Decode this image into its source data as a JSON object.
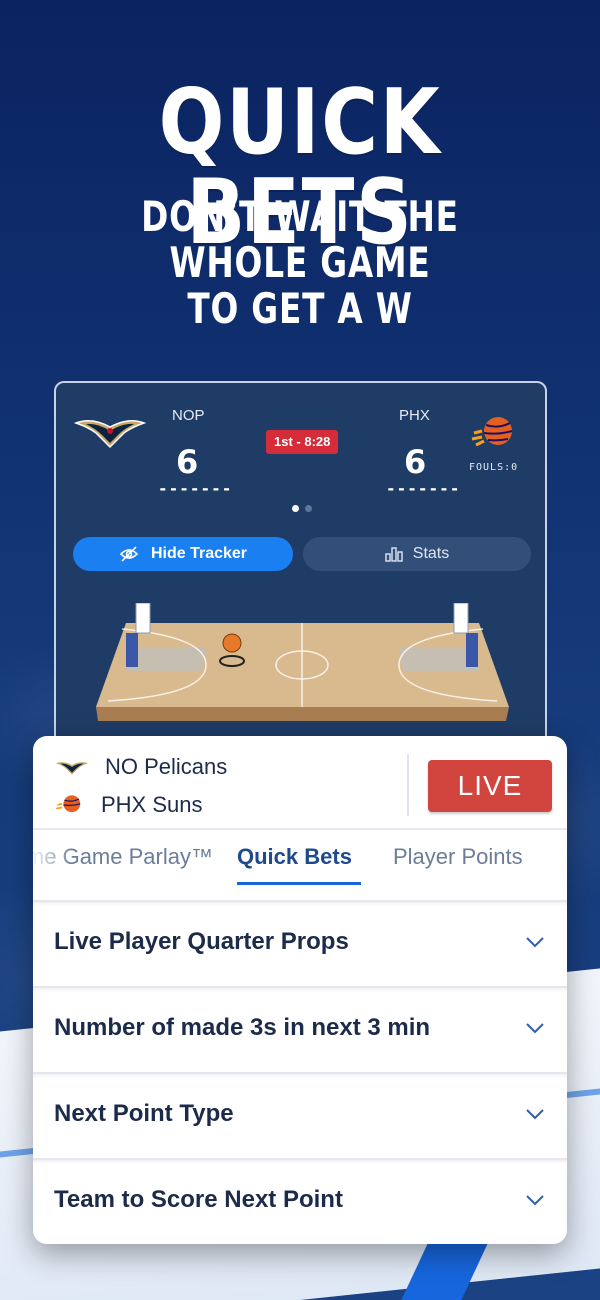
{
  "hero": {
    "title": "QUICK BETS",
    "subtitle_line1": "DON’T WAIT THE WHOLE GAME",
    "subtitle_line2": "TO GET A W"
  },
  "tracker": {
    "home": {
      "abbr": "NOP",
      "score": "6",
      "shots": "-------"
    },
    "away": {
      "abbr": "PHX",
      "score": "6",
      "shots": "-------",
      "fouls": "FOULS:0"
    },
    "clock": "1st - 8:28",
    "pager": {
      "total": 2,
      "active": 1
    },
    "hide_tracker_label": "Hide Tracker",
    "stats_label": "Stats"
  },
  "matchup": {
    "team1": "NO Pelicans",
    "team2": "PHX Suns",
    "live_label": "LIVE"
  },
  "tabs": [
    {
      "label": "Same Game Parlay™"
    },
    {
      "label": "Quick Bets",
      "active": true
    },
    {
      "label": "Player Points"
    }
  ],
  "markets": [
    {
      "label": "Live Player Quarter Props"
    },
    {
      "label": "Number of made 3s in next 3 min"
    },
    {
      "label": "Next Point Type"
    },
    {
      "label": "Team to Score Next Point"
    }
  ],
  "colors": {
    "brand_blue": "#1766de",
    "navy_bg": "#0b2361",
    "live_red": "#d2453f",
    "clock_red": "#d62c3a",
    "tracker_bg": "#1f3c66"
  }
}
